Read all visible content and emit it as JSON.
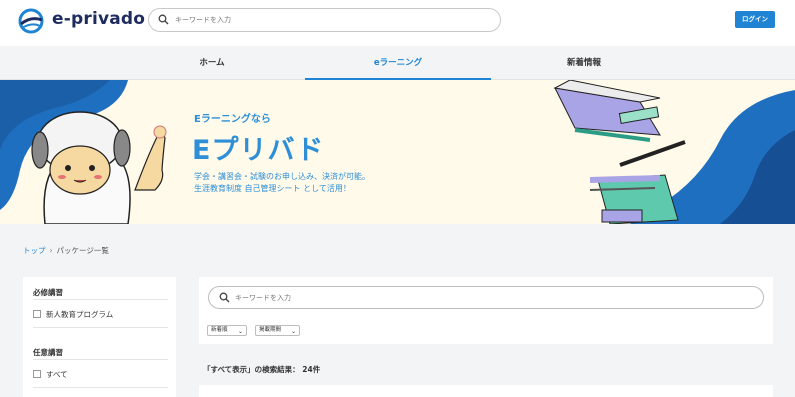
{
  "header": {
    "logo_text": "e-privado",
    "search_placeholder": "キーワードを入力",
    "login_label": "ログイン"
  },
  "nav": {
    "items": [
      {
        "label": "ホーム",
        "active": false
      },
      {
        "label": "eラーニング",
        "active": true
      },
      {
        "label": "新着情報",
        "active": false
      }
    ]
  },
  "banner": {
    "subtitle": "Eラーニングなら",
    "title": "Eプリバド",
    "line1": "学会・講習会・試験のお申し込み、決済が可能。",
    "line2": "生涯教育制度 自己管理シート として活用！"
  },
  "breadcrumb": {
    "home": "トップ",
    "separator": "›",
    "current": "パッケージ一覧"
  },
  "sidebar": {
    "required_heading": "必修講習",
    "required_items": [
      "新人教育プログラム"
    ],
    "optional_heading": "任意講習",
    "optional_items": [
      "すべて"
    ]
  },
  "main": {
    "search_placeholder": "キーワードを入力",
    "sort_options": [
      "新着順",
      "掲載期間"
    ],
    "result_text": "「すべて表示」の検索結果： 24件"
  },
  "colors": {
    "accent": "#1f84d4",
    "banner_bg": "#fffaea",
    "banner_text": "#2e8fd7",
    "wave": "#1e6fc0"
  }
}
